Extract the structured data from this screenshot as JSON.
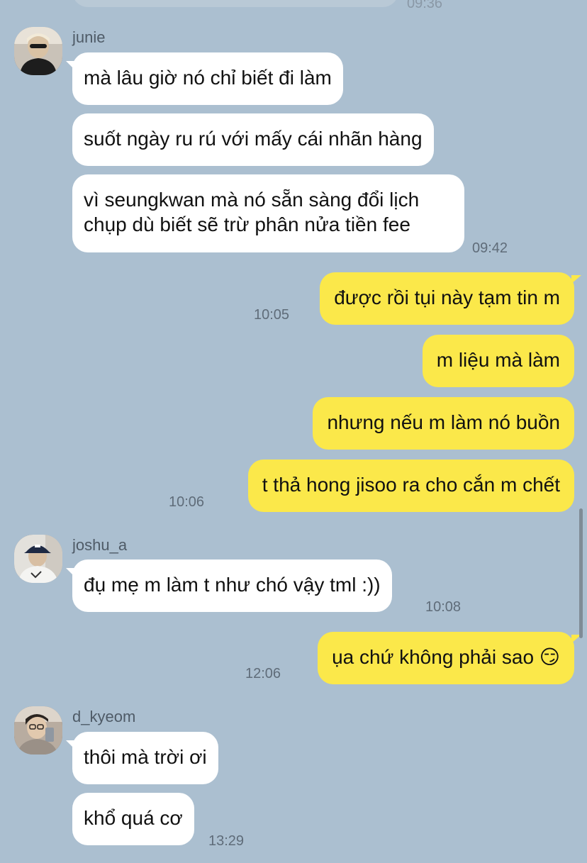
{
  "top_partial": {
    "time": "09:36"
  },
  "groups": [
    {
      "sender": "junie",
      "messages": [
        "mà lâu giờ nó chỉ biết đi làm",
        "suốt ngày ru rú với mấy cái nhãn hàng",
        "vì seungkwan mà nó sẵn sàng đổi lịch chụp dù biết sẽ trừ phân nửa tiền fee"
      ],
      "time": "09:42"
    },
    {
      "sender": "me",
      "messages": [
        "được rồi tụi này tạm tin m",
        "m liệu mà làm",
        "nhưng nếu m làm nó buồn",
        "t thả hong jisoo ra cho cắn m chết"
      ],
      "times": [
        "10:05",
        "10:06"
      ]
    },
    {
      "sender": "joshu_a",
      "messages": [
        "đụ mẹ m làm t như chó vậy tml :))"
      ],
      "time": "10:08"
    },
    {
      "sender": "me",
      "messages": [
        "ụa chứ không phải sao 😏"
      ],
      "time": "12:06"
    },
    {
      "sender": "d_kyeom",
      "messages": [
        "thôi mà trời ơi",
        "khổ quá cơ"
      ],
      "time": "13:29"
    }
  ],
  "icons": {
    "avatar_junie": "avatar-photo",
    "avatar_joshu_a": "avatar-photo",
    "avatar_d_kyeom": "avatar-photo"
  },
  "colors": {
    "background": "#abbfd0",
    "incoming_bubble": "#ffffff",
    "outgoing_bubble": "#fbe84a"
  }
}
